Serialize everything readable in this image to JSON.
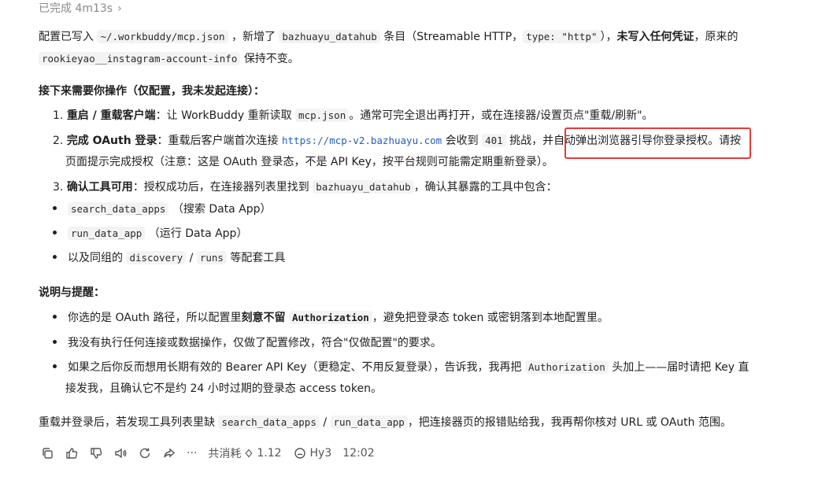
{
  "status": {
    "text": "已完成 4m13s",
    "chevron": "›"
  },
  "intro": {
    "line1_a": "配置已写入",
    "line1_code1": "~/.workbuddy/mcp.json",
    "line1_b": "，新增了",
    "line1_code2": "bazhuayu_datahub",
    "line1_c": "条目（Streamable HTTP，",
    "line1_code3": "type: \"http\"",
    "line1_d": "），",
    "line1_bold": "未写入任何凭证",
    "line1_e": "，原来的",
    "line2_code": "rookieyao__instagram-account-info",
    "line2_a": "保持不变。"
  },
  "next_steps": {
    "heading": "接下来需要你操作（仅配置，我未发起连接）：",
    "step1_num": "1.",
    "step1_bold": "重启 / 重载客户端",
    "step1_a": "：让 WorkBuddy 重新读取",
    "step1_code": "mcp.json",
    "step1_b": "。通常可完全退出再打开，或在连接器/设置页点\"重载/刷新\"。",
    "step2_num": "2.",
    "step2_bold": "完成 OAuth 登录",
    "step2_a": "：重载后客户端首次连接",
    "step2_link": "https://mcp-v2.bazhuayu.com",
    "step2_b": "会收到",
    "step2_code": "401",
    "step2_c": "挑战，",
    "step2_highlight": "并自动弹出浏览器引导你登录授权。",
    "step2_d": "请按",
    "step2_line2": "页面提示完成授权（注意：这是 OAuth 登录态，不是 API Key，按平台规则可能需定期重新登录）。",
    "step3_num": "3.",
    "step3_bold": "确认工具可用",
    "step3_a": "：授权成功后，在连接器列表里找到",
    "step3_code": "bazhuayu_datahub",
    "step3_b": "，确认其暴露的工具中包含：",
    "tools": [
      {
        "code": "search_data_apps",
        "text": "（搜索 Data App）"
      },
      {
        "code": "run_data_app",
        "text": "（运行 Data App）"
      }
    ],
    "tool3_a": "以及同组的",
    "tool3_code1": "discovery",
    "tool3_sep": "/",
    "tool3_code2": "runs",
    "tool3_b": "等配套工具"
  },
  "notes": {
    "heading": "说明与提醒：",
    "n1_a": "你选的是 OAuth 路径，所以配置里",
    "n1_bold": "刻意不留",
    "n1_code": "Authorization",
    "n1_b": "，避免把登录态 token 或密钥落到本地配置里。",
    "n2": "我没有执行任何连接或数据操作，仅做了配置修改，符合\"仅做配置\"的要求。",
    "n3_a": "如果之后你反而想用长期有效的 Bearer API Key（更稳定、不用反复登录），告诉我，我再把",
    "n3_code": "Authorization",
    "n3_b": "头加上——届时请把 Key 直",
    "n3_line2": "接发我，且确认它不是约 24 小时过期的登录态 access token。"
  },
  "footer": {
    "a": "重载并登录后，若发现工具列表里缺",
    "code1": "search_data_apps",
    "sep": "/",
    "code2": "run_data_app",
    "b": "，把连接器页的报错贴给我，我再帮你核对 URL 或 OAuth 范围。"
  },
  "toolbar": {
    "more": "···",
    "cost_label": "共消耗",
    "cost_value": "1.12",
    "model": "Hy3",
    "time": "12:02"
  }
}
